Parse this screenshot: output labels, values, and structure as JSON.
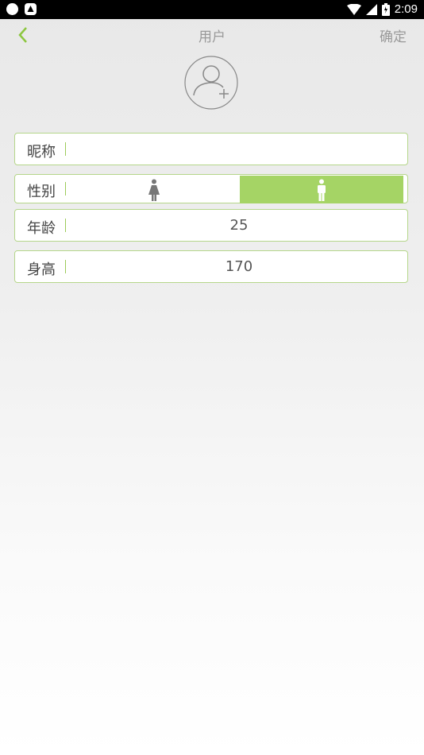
{
  "statusbar": {
    "time": "2:09"
  },
  "header": {
    "title": "用户",
    "confirm_label": "确定"
  },
  "avatar": {
    "icon": "add-user-icon"
  },
  "form": {
    "nickname": {
      "label": "昵称",
      "value": ""
    },
    "gender": {
      "label": "性别",
      "options": [
        "female",
        "male"
      ],
      "selected": "male"
    },
    "age": {
      "label": "年龄",
      "value": "25"
    },
    "height": {
      "label": "身高",
      "value": "170"
    }
  },
  "colors": {
    "accent": "#a5d465",
    "border": "#b5d68a",
    "text": "#444444",
    "muted": "#999999"
  }
}
